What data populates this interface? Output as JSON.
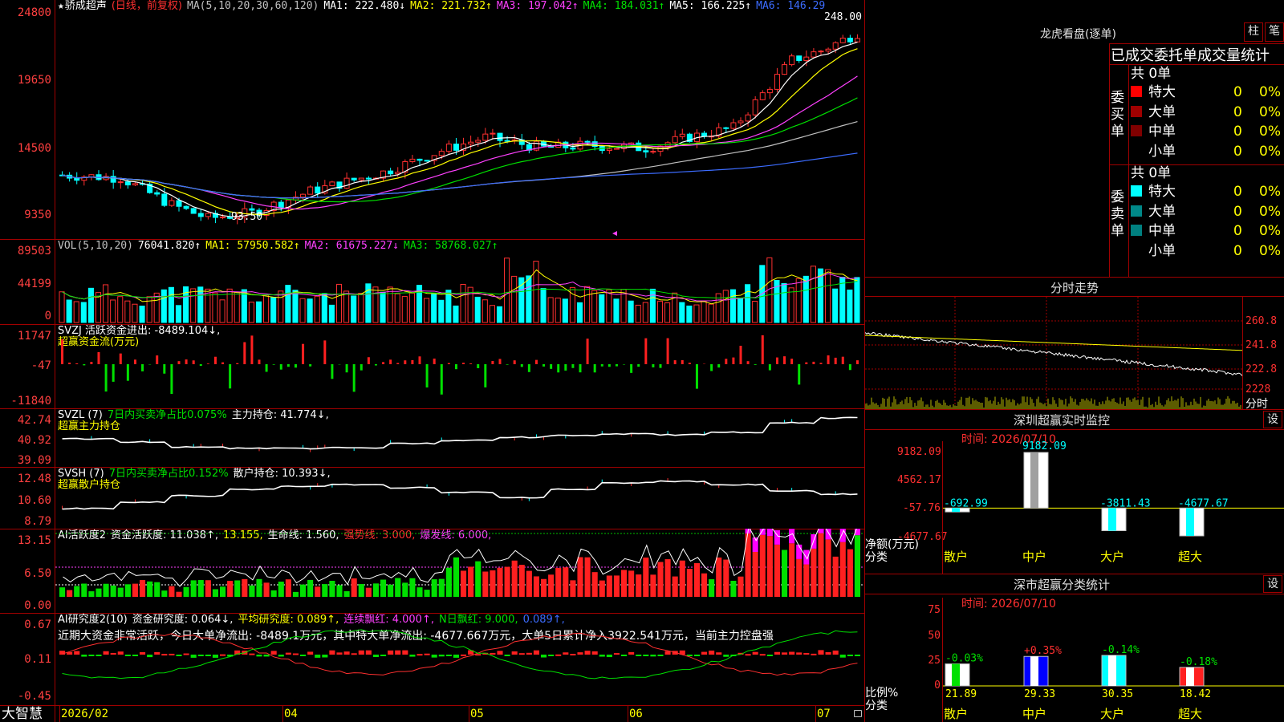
{
  "app": {
    "brand": "大智慧"
  },
  "main_chart": {
    "star": "★",
    "stock_name": "骄成超声",
    "mode": "(日线，前复权)",
    "ma_label": "MA(5,10,20,30,60,120)",
    "ma1": "MA1: 222.480↓",
    "ma2": "MA2: 221.732↑",
    "ma3": "MA3: 197.042↑",
    "ma4": "MA4: 184.031↑",
    "ma5": "MA5: 166.225↑",
    "ma6": "MA6: 146.29",
    "yticks": [
      "24800",
      "19650",
      "14500",
      "9350"
    ],
    "high_label": "248.00",
    "low_label": "93.50"
  },
  "vol": {
    "title": "VOL(5,10,20)",
    "value": "76041.820↑",
    "ma1": "MA1: 57950.582↑",
    "ma2": "MA2: 61675.227↓",
    "ma3": "MA3: 58768.027↑",
    "yticks": [
      "89503",
      "44199",
      "0"
    ]
  },
  "svzj": {
    "title": "SVZJ  活跃资金进出: -8489.104↓,",
    "subtitle": "超赢资金流(万元)",
    "yticks": [
      "11747",
      "-47",
      "-11840"
    ]
  },
  "svzl": {
    "title": "SVZL (7)",
    "pct": "7日内买卖净占比0.075%",
    "hold": "主力持仓: 41.774↓,",
    "subtitle": "超赢主力持仓",
    "yticks": [
      "42.74",
      "40.92",
      "39.09"
    ]
  },
  "svsh": {
    "title": "SVSH (7)",
    "pct": "7日内买卖净占比0.152%",
    "hold": "散户持仓: 10.393↓,",
    "subtitle": "超赢散户持仓",
    "yticks": [
      "12.48",
      "10.60",
      "8.79"
    ]
  },
  "ai_active": {
    "title": "AI活跃度2",
    "v1": "资金活跃度: 11.038↑,",
    "v2": "13.155,",
    "v3": "生命线: 1.560,",
    "v4": "强势线: 3.000,",
    "v5": "爆发线: 6.000,",
    "yticks": [
      "13.15",
      "6.50",
      "0.00"
    ]
  },
  "ai_research": {
    "title": "AI研究度2(10)",
    "v1": "资金研究度: 0.064↓,",
    "v2": "平均研究度: 0.089↑,",
    "v3": "连续飘红: 4.000↑,",
    "v4": "N日飘红: 9.000,",
    "v5": "0.089↑,",
    "note": "近期大资金非常活跃，今日大单净流出: -8489.1万元，其中特大单净流出: -4677.667万元，大单5日累计净入3922.541万元，当前主力控盘强",
    "yticks": [
      "0.67",
      "0.11",
      "-0.45"
    ]
  },
  "xaxis": {
    "labels": [
      "2026/02",
      "04",
      "05",
      "06",
      "07"
    ]
  },
  "longhu": {
    "title": "龙虎看盘(逐单)",
    "btn1": "柱",
    "btn2": "笔",
    "header": "已成交委托单成交量统计",
    "buy_side": "委买单",
    "sell_side": "委卖单",
    "buy_total": "共 0单",
    "sell_total": "共 0单",
    "buy_rows": [
      {
        "label": "特大",
        "count": "0",
        "pct": "0%"
      },
      {
        "label": "大单",
        "count": "0",
        "pct": "0%"
      },
      {
        "label": "中单",
        "count": "0",
        "pct": "0%"
      },
      {
        "label": "小单",
        "count": "0",
        "pct": "0%"
      }
    ],
    "sell_rows": [
      {
        "label": "特大",
        "count": "0",
        "pct": "0%"
      },
      {
        "label": "大单",
        "count": "0",
        "pct": "0%"
      },
      {
        "label": "中单",
        "count": "0",
        "pct": "0%"
      },
      {
        "label": "小单",
        "count": "0",
        "pct": "0%"
      }
    ],
    "buy_colors": [
      "#ff0000",
      "#a00000",
      "#800000",
      "#000000"
    ],
    "sell_colors": [
      "#00ffff",
      "#008888",
      "#008080",
      "#000000"
    ]
  },
  "fenshi": {
    "title": "分时走势",
    "yticks": [
      "260.8",
      "241.8",
      "222.8",
      "2228"
    ],
    "unit": "分时"
  },
  "sz_monitor": {
    "title": "深圳超赢实时监控",
    "setting": "设",
    "time": "时间: 2026/07/10",
    "yticks": [
      "9182.09",
      "4562.17",
      "-57.76",
      "-4677.67"
    ],
    "ylabel1": "净额(万元)",
    "ylabel2": "分类",
    "bars": [
      {
        "cat": "散户",
        "value": -692.99,
        "label": "-692.99"
      },
      {
        "cat": "中户",
        "value": 9182.09,
        "label": "9182.09"
      },
      {
        "cat": "大户",
        "value": -3811.43,
        "label": "-3811.43"
      },
      {
        "cat": "超大",
        "value": -4677.67,
        "label": "-4677.67"
      }
    ]
  },
  "sz_class": {
    "title": "深市超赢分类统计",
    "setting": "设",
    "time": "时间: 2026/07/10",
    "yticks": [
      "75",
      "50",
      "25",
      "0"
    ],
    "ylabel1": "比例%",
    "ylabel2": "分类",
    "bars": [
      {
        "cat": "散户",
        "value": 21.89,
        "label": "21.89",
        "change": "-0.03%"
      },
      {
        "cat": "中户",
        "value": 29.33,
        "label": "29.33",
        "change": "+0.35%"
      },
      {
        "cat": "大户",
        "value": 30.35,
        "label": "30.35",
        "change": "-0.14%"
      },
      {
        "cat": "超大",
        "value": 18.42,
        "label": "18.42",
        "change": "-0.18%"
      }
    ]
  }
}
